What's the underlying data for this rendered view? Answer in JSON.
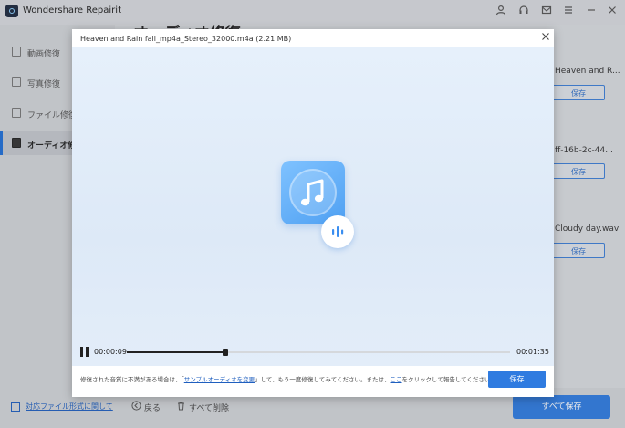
{
  "app": {
    "title": "Wondershare Repairit"
  },
  "titlebar_icons": [
    "user-icon",
    "headset-icon",
    "mail-icon",
    "menu-icon",
    "minimize-icon",
    "close-icon"
  ],
  "sidebar": {
    "items": [
      {
        "label": "動画修復",
        "icon": "video-icon",
        "active": false
      },
      {
        "label": "写真修復",
        "icon": "photo-icon",
        "active": false
      },
      {
        "label": "ファイル修復",
        "icon": "file-icon",
        "active": false
      },
      {
        "label": "オーディオ修復",
        "icon": "audio-file-icon",
        "active": true
      }
    ],
    "footer_link": "対応ファイル形式に関して"
  },
  "main": {
    "title": "オーディオ修復",
    "files": [
      {
        "name": "Heaven and R...",
        "save_label": "保存"
      },
      {
        "name": "ff-16b-2c-44...",
        "save_label": "保存"
      },
      {
        "name": "Cloudy day.wav",
        "save_label": "保存"
      }
    ]
  },
  "bottombar": {
    "back_label": "戻る",
    "delete_all_label": "すべて削除",
    "save_all_label": "すべて保存"
  },
  "modal": {
    "filename": "Heaven and Rain fall_mp4a_Stereo_32000.m4a (2.21 MB)",
    "player": {
      "current_time": "00:00:09",
      "total_time": "00:01:35",
      "progress": 0.257
    },
    "hint": {
      "part1": "修復された音質に不満がある場合は、「",
      "link1": "サンプルオーディオを変更",
      "part2": "」して、もう一度修復してみてください。または、",
      "link2": "ここ",
      "part3": "をクリックして報告してください。"
    },
    "save_label": "保存"
  },
  "colors": {
    "accent": "#2f7be0",
    "tile_light": "#7fc2ff",
    "tile_dark": "#4fa0f2"
  }
}
